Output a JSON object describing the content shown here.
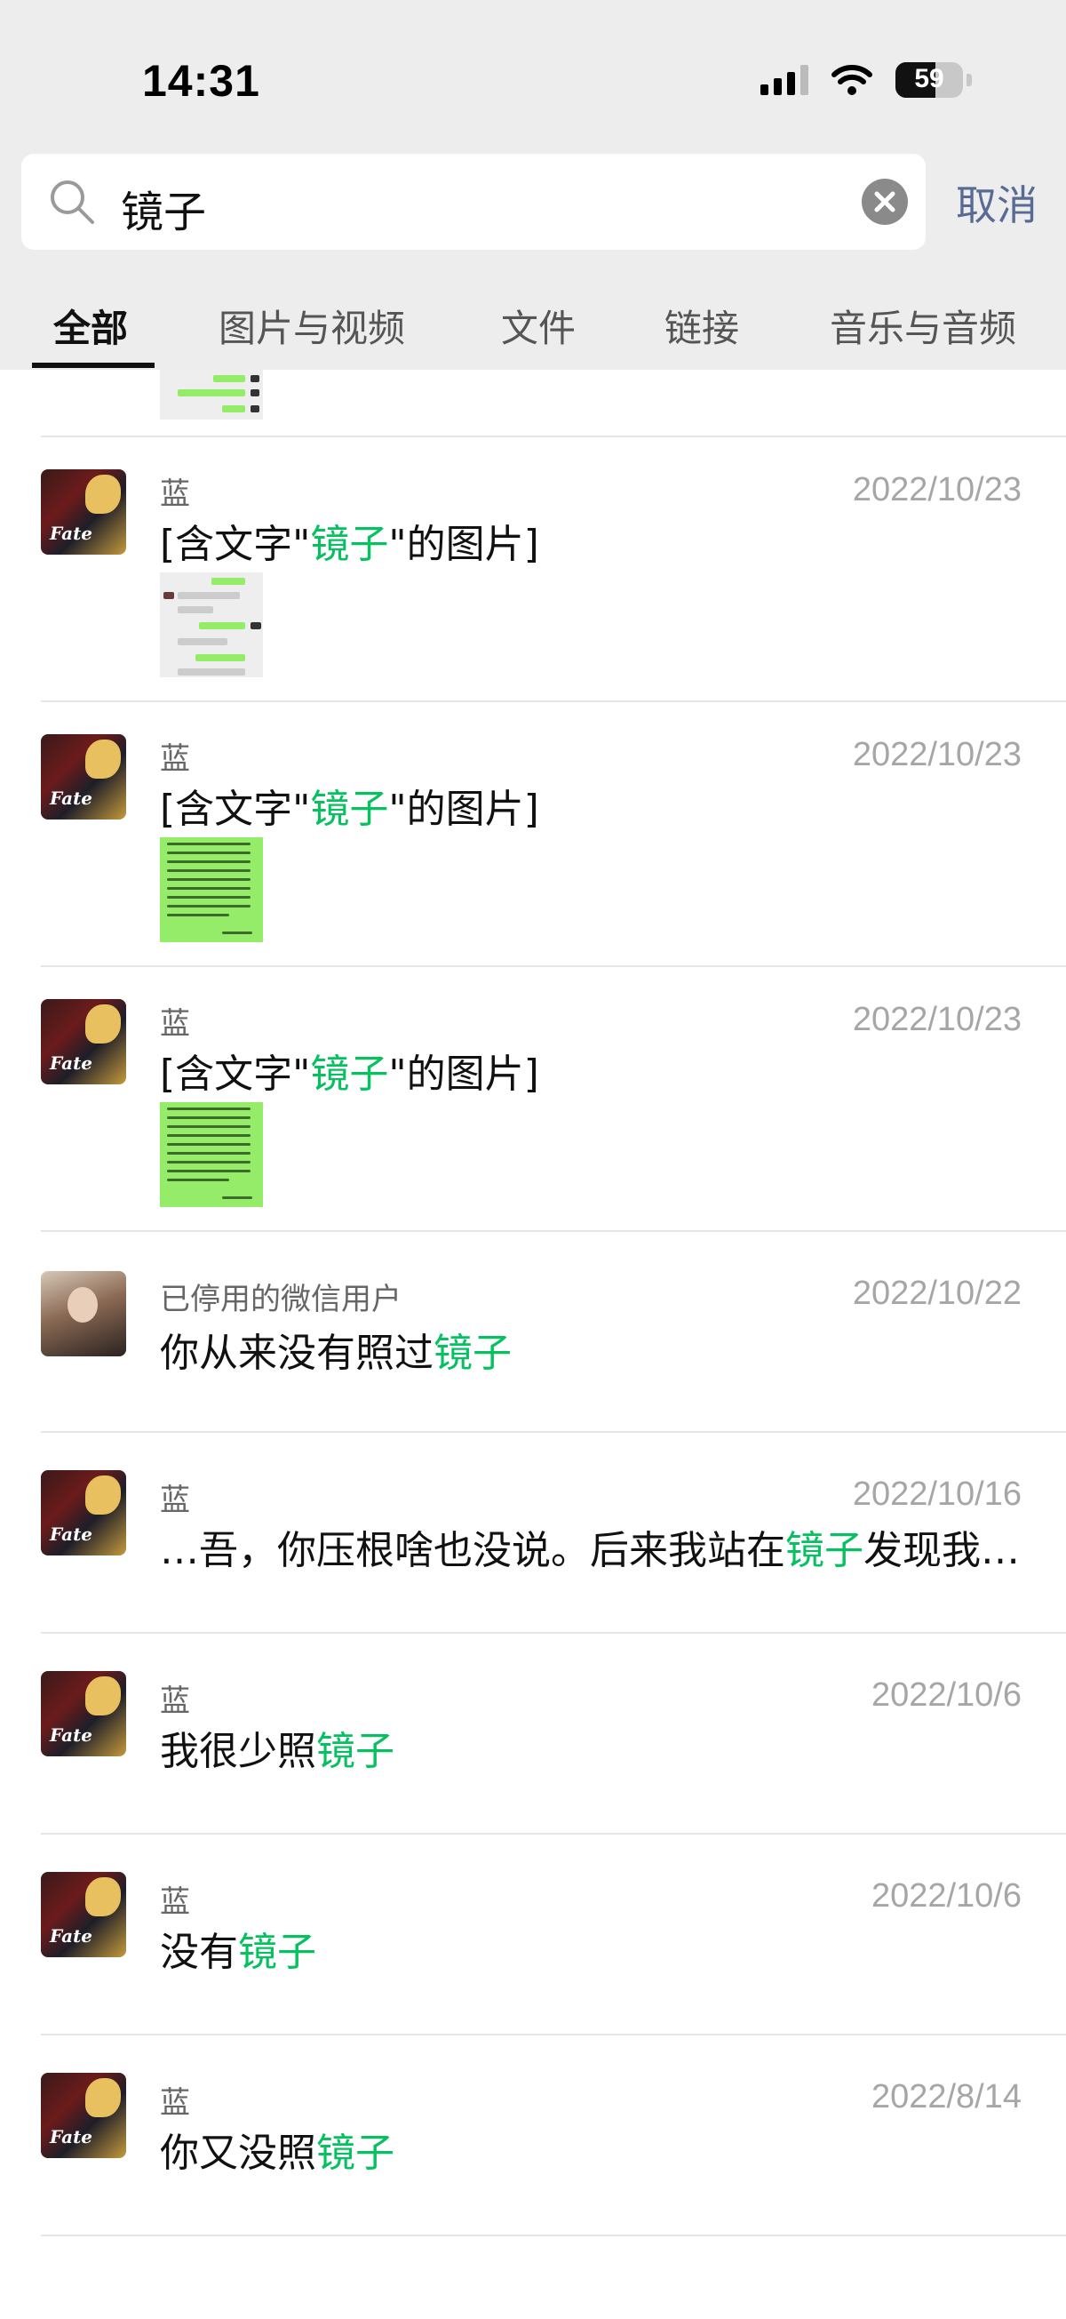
{
  "status_bar": {
    "time": "14:31",
    "battery": "59"
  },
  "search": {
    "query": "镜子",
    "cancel_label": "取消"
  },
  "tabs": [
    {
      "label": "全部",
      "active": true
    },
    {
      "label": "图片与视频",
      "active": false
    },
    {
      "label": "文件",
      "active": false
    },
    {
      "label": "链接",
      "active": false
    },
    {
      "label": "音乐与音频",
      "active": false
    }
  ],
  "image_label": {
    "prefix": "[含文字\"",
    "keyword": "镜子",
    "suffix": "\"的图片]"
  },
  "results": [
    {
      "sender": "蓝",
      "date": "2022/10/23",
      "type": "image"
    },
    {
      "sender": "蓝",
      "date": "2022/10/23",
      "type": "image"
    },
    {
      "sender": "蓝",
      "date": "2022/10/23",
      "type": "image"
    },
    {
      "sender": "已停用的微信用户",
      "date": "2022/10/22",
      "type": "text",
      "before": "你从来没有照过",
      "keyword": "镜子",
      "after": ""
    },
    {
      "sender": "蓝",
      "date": "2022/10/16",
      "type": "text",
      "before": "…吾，你压根啥也没说。后来我站在",
      "keyword": "镜子",
      "after": "发现我…"
    },
    {
      "sender": "蓝",
      "date": "2022/10/6",
      "type": "text",
      "before": "我很少照",
      "keyword": "镜子",
      "after": ""
    },
    {
      "sender": "蓝",
      "date": "2022/10/6",
      "type": "text",
      "before": "没有",
      "keyword": "镜子",
      "after": ""
    },
    {
      "sender": "蓝",
      "date": "2022/8/14",
      "type": "text",
      "before": "你又没照",
      "keyword": "镜子",
      "after": ""
    }
  ],
  "colors": {
    "highlight": "#07c160",
    "link": "#576b95",
    "header_bg": "#ededed"
  }
}
